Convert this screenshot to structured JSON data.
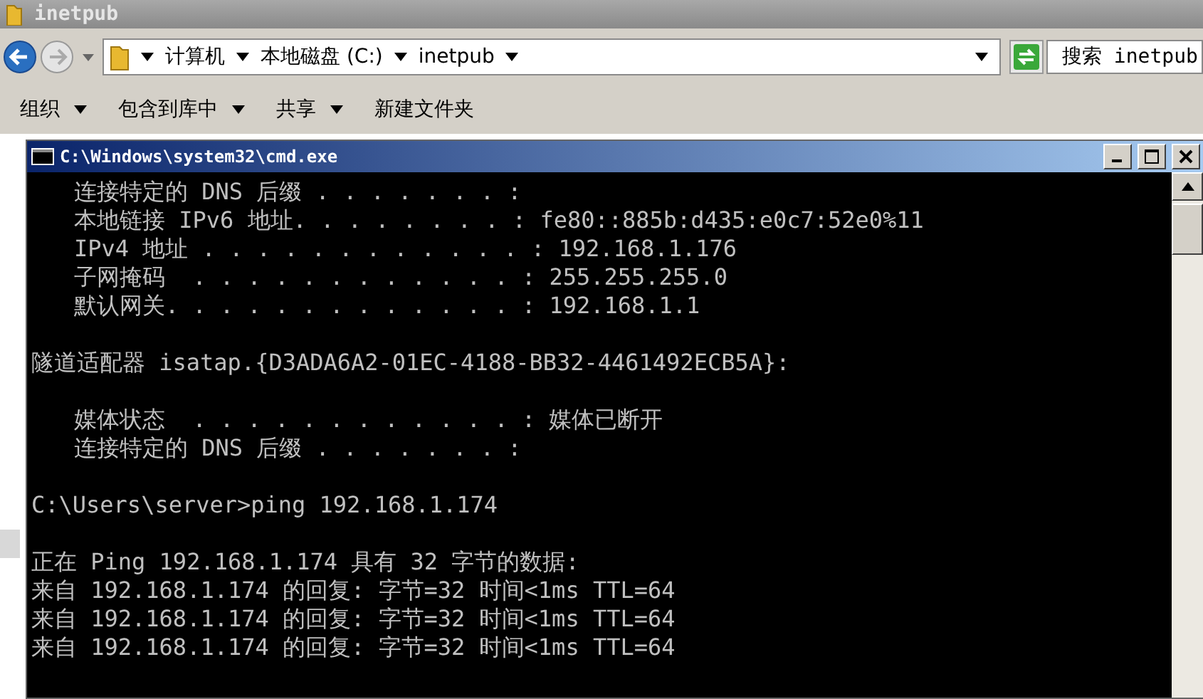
{
  "explorer": {
    "title": "inetpub",
    "breadcrumb": [
      "计算机",
      "本地磁盘 (C:)",
      "inetpub"
    ],
    "search": {
      "placeholder": "搜索 inetpub"
    },
    "toolbar": [
      {
        "label": "组织",
        "dropdown": true
      },
      {
        "label": "包含到库中",
        "dropdown": true
      },
      {
        "label": "共享",
        "dropdown": true
      },
      {
        "label": "新建文件夹",
        "dropdown": false
      }
    ]
  },
  "cmd": {
    "title": "C:\\Windows\\system32\\cmd.exe",
    "blocks": [
      [
        {
          "text": "连接特定的 DNS 后缀 . . . . . . . :",
          "indented": true
        },
        {
          "text": "本地链接 IPv6 地址. . . . . . . . : fe80::885b:d435:e0c7:52e0%11",
          "indented": true
        },
        {
          "text": "IPv4 地址 . . . . . . . . . . . . : 192.168.1.176",
          "indented": true
        },
        {
          "text": "子网掩码  . . . . . . . . . . . . : 255.255.255.0",
          "indented": true
        },
        {
          "text": "默认网关. . . . . . . . . . . . . : 192.168.1.1",
          "indented": true
        }
      ],
      [
        {
          "text": "隧道适配器 isatap.{D3ADA6A2-01EC-4188-BB32-4461492ECB5A}:",
          "indented": false
        }
      ],
      [
        {
          "text": "媒体状态  . . . . . . . . . . . . : 媒体已断开",
          "indented": true
        },
        {
          "text": "连接特定的 DNS 后缀 . . . . . . . :",
          "indented": true
        }
      ],
      [
        {
          "text": "C:\\Users\\server>ping 192.168.1.174",
          "indented": false
        }
      ],
      [
        {
          "text": "正在 Ping 192.168.1.174 具有 32 字节的数据:",
          "indented": false
        },
        {
          "text": "来自 192.168.1.174 的回复: 字节=32 时间<1ms TTL=64",
          "indented": false
        },
        {
          "text": "来自 192.168.1.174 的回复: 字节=32 时间<1ms TTL=64",
          "indented": false
        },
        {
          "text": "来自 192.168.1.174 的回复: 字节=32 时间<1ms TTL=64",
          "indented": false
        }
      ]
    ]
  }
}
